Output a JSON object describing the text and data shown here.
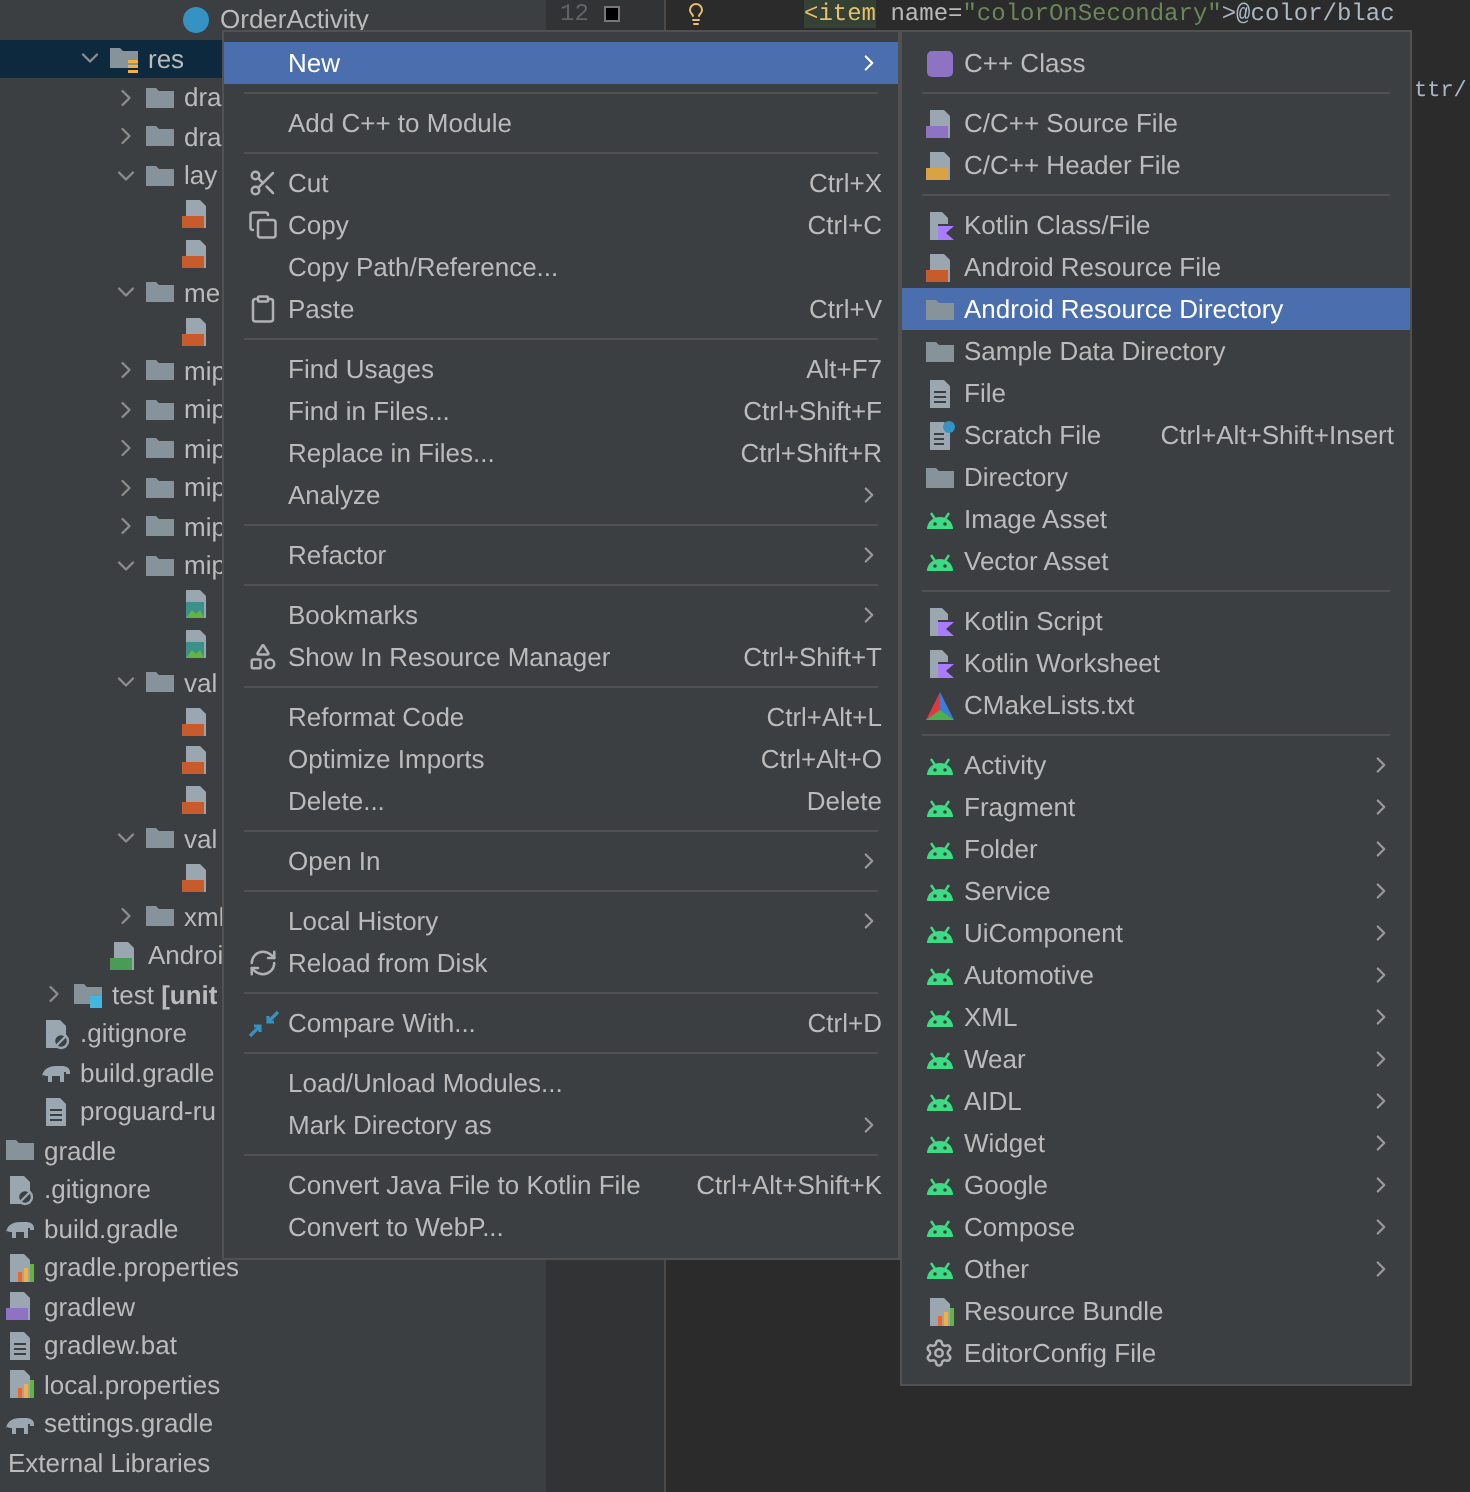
{
  "project_tree": {
    "sections": [
      {
        "kind": "source",
        "items": [
          {
            "label": "OrderActivity",
            "kind": "class",
            "selected": false
          }
        ]
      },
      {
        "kind": "main",
        "items": [
          {
            "label": "res",
            "kind": "res",
            "expanded": true,
            "selected": true,
            "children": [
              {
                "label": "dra",
                "kind": "folder",
                "expanded": false,
                "selected": false
              },
              {
                "label": "dra",
                "kind": "folder",
                "expanded": false,
                "selected": false
              },
              {
                "label": "lay",
                "kind": "folder",
                "expanded": true,
                "selected": false,
                "children": [
                  {
                    "kind": "xml",
                    "selected": false
                  },
                  {
                    "kind": "xml",
                    "selected": false
                  }
                ]
              },
              {
                "label": "me",
                "kind": "folder",
                "expanded": true,
                "selected": false,
                "children": [
                  {
                    "kind": "xml",
                    "selected": false
                  }
                ]
              },
              {
                "label": "mip",
                "kind": "folder",
                "expanded": false,
                "selected": false
              },
              {
                "label": "mip",
                "kind": "folder",
                "expanded": false,
                "selected": false
              },
              {
                "label": "mip",
                "kind": "folder",
                "expanded": false,
                "selected": false
              },
              {
                "label": "mip",
                "kind": "folder",
                "expanded": false,
                "selected": false
              },
              {
                "label": "mip",
                "kind": "folder",
                "expanded": false,
                "selected": false
              },
              {
                "label": "mip",
                "kind": "folder",
                "expanded": true,
                "selected": false,
                "children": [
                  {
                    "kind": "image",
                    "selected": false
                  },
                  {
                    "kind": "image",
                    "selected": false
                  }
                ]
              },
              {
                "label": "val",
                "kind": "folder",
                "expanded": true,
                "selected": false,
                "children": [
                  {
                    "kind": "xml",
                    "selected": false
                  },
                  {
                    "kind": "xml",
                    "selected": false
                  },
                  {
                    "kind": "xml",
                    "selected": false
                  }
                ]
              },
              {
                "label": "val",
                "kind": "folder",
                "expanded": true,
                "selected": false,
                "children": [
                  {
                    "kind": "xml",
                    "selected": false
                  }
                ]
              },
              {
                "label": "xml",
                "kind": "folder",
                "expanded": false,
                "selected": false
              }
            ]
          },
          {
            "label": "Androi",
            "kind": "manifest",
            "selected": false
          }
        ]
      },
      {
        "kind": "module",
        "items": [
          {
            "label": "test **[unit**",
            "kind": "test",
            "expanded": false,
            "selected": false
          },
          {
            "label": ".gitignore",
            "kind": "ignore",
            "selected": false
          },
          {
            "label": "build.gradle",
            "kind": "gradle",
            "selected": false
          },
          {
            "label": "proguard-ru",
            "kind": "text",
            "selected": false
          }
        ]
      },
      {
        "kind": "project",
        "items": [
          {
            "label": "gradle",
            "kind": "folder",
            "selected": false
          },
          {
            "label": ".gitignore",
            "kind": "ignore",
            "selected": false
          },
          {
            "label": "build.gradle",
            "kind": "gradle",
            "selected": false
          },
          {
            "label": "gradle.properties",
            "kind": "properties",
            "selected": false
          },
          {
            "label": "gradlew",
            "kind": "script",
            "selected": false
          },
          {
            "label": "gradlew.bat",
            "kind": "text",
            "selected": false
          },
          {
            "label": "local.properties",
            "kind": "properties",
            "selected": false
          },
          {
            "label": "settings.gradle",
            "kind": "gradle",
            "selected": false
          },
          {
            "label": "External Libraries",
            "kind": "plain",
            "selected": false
          }
        ]
      }
    ]
  },
  "editor": {
    "line_number": "12",
    "code_line": [
      {
        "kind": "tag",
        "text": "<item"
      },
      {
        "kind": "attr",
        "text": " name="
      },
      {
        "kind": "string",
        "text": "\"colorOnSecondary\""
      },
      {
        "kind": "text",
        "text": ">@color/blac"
      }
    ],
    "fragment": "ttr/"
  },
  "context_menu": {
    "items": [
      {
        "kind": "plain",
        "label": "New",
        "submenu": true,
        "selected": true
      },
      {
        "kind": "separator"
      },
      {
        "kind": "plain",
        "label": "Add C++ to Module",
        "submenu": false,
        "selected": false
      },
      {
        "kind": "separator"
      },
      {
        "kind": "cut",
        "label": "Cut",
        "shortcut": "Ctrl+X",
        "submenu": false,
        "selected": false
      },
      {
        "kind": "copy",
        "label": "Copy",
        "shortcut": "Ctrl+C",
        "submenu": false,
        "selected": false
      },
      {
        "kind": "plain",
        "label": "Copy Path/Reference...",
        "submenu": false,
        "selected": false
      },
      {
        "kind": "paste",
        "label": "Paste",
        "shortcut": "Ctrl+V",
        "submenu": false,
        "selected": false
      },
      {
        "kind": "separator"
      },
      {
        "kind": "plain",
        "label": "Find Usages",
        "shortcut": "Alt+F7",
        "submenu": false,
        "selected": false
      },
      {
        "kind": "plain",
        "label": "Find in Files...",
        "shortcut": "Ctrl+Shift+F",
        "submenu": false,
        "selected": false
      },
      {
        "kind": "plain",
        "label": "Replace in Files...",
        "shortcut": "Ctrl+Shift+R",
        "submenu": false,
        "selected": false
      },
      {
        "kind": "plain",
        "label": "Analyze",
        "submenu": true,
        "selected": false
      },
      {
        "kind": "separator"
      },
      {
        "kind": "plain",
        "label": "Refactor",
        "submenu": true,
        "selected": false
      },
      {
        "kind": "separator"
      },
      {
        "kind": "plain",
        "label": "Bookmarks",
        "submenu": true,
        "selected": false
      },
      {
        "kind": "resources",
        "label": "Show In Resource Manager",
        "shortcut": "Ctrl+Shift+T",
        "submenu": false,
        "selected": false
      },
      {
        "kind": "separator"
      },
      {
        "kind": "plain",
        "label": "Reformat Code",
        "shortcut": "Ctrl+Alt+L",
        "submenu": false,
        "selected": false
      },
      {
        "kind": "plain",
        "label": "Optimize Imports",
        "shortcut": "Ctrl+Alt+O",
        "submenu": false,
        "selected": false
      },
      {
        "kind": "plain",
        "label": "Delete...",
        "shortcut": "Delete",
        "submenu": false,
        "selected": false
      },
      {
        "kind": "separator"
      },
      {
        "kind": "plain",
        "label": "Open In",
        "submenu": true,
        "selected": false
      },
      {
        "kind": "separator"
      },
      {
        "kind": "plain",
        "label": "Local History",
        "submenu": true,
        "selected": false
      },
      {
        "kind": "reload",
        "label": "Reload from Disk",
        "submenu": false,
        "selected": false
      },
      {
        "kind": "separator"
      },
      {
        "kind": "compare",
        "label": "Compare With...",
        "shortcut": "Ctrl+D",
        "submenu": false,
        "selected": false
      },
      {
        "kind": "separator"
      },
      {
        "kind": "plain",
        "label": "Load/Unload Modules...",
        "submenu": false,
        "selected": false
      },
      {
        "kind": "plain",
        "label": "Mark Directory as",
        "submenu": true,
        "selected": false
      },
      {
        "kind": "separator"
      },
      {
        "kind": "plain",
        "label": "Convert Java File to Kotlin File",
        "shortcut": "Ctrl+Alt+Shift+K",
        "submenu": false,
        "selected": false
      },
      {
        "kind": "plain",
        "label": "Convert to WebP...",
        "submenu": false,
        "selected": false
      }
    ]
  },
  "new_submenu": {
    "items": [
      {
        "kind": "cpp_class",
        "label": "C++ Class",
        "submenu": false,
        "selected": false
      },
      {
        "kind": "separator"
      },
      {
        "kind": "cpp_source",
        "label": "C/C++ Source File",
        "submenu": false,
        "selected": false
      },
      {
        "kind": "cpp_header",
        "label": "C/C++ Header File",
        "submenu": false,
        "selected": false
      },
      {
        "kind": "separator"
      },
      {
        "kind": "kotlin",
        "label": "Kotlin Class/File",
        "submenu": false,
        "selected": false
      },
      {
        "kind": "resource_file",
        "label": "Android Resource File",
        "submenu": false,
        "selected": false
      },
      {
        "kind": "directory",
        "label": "Android Resource Directory",
        "submenu": false,
        "selected": true
      },
      {
        "kind": "directory",
        "label": "Sample Data Directory",
        "submenu": false,
        "selected": false
      },
      {
        "kind": "file",
        "label": "File",
        "submenu": false,
        "selected": false
      },
      {
        "kind": "scratch",
        "label": "Scratch File",
        "shortcut": "Ctrl+Alt+Shift+Insert",
        "submenu": false,
        "selected": false
      },
      {
        "kind": "directory",
        "label": "Directory",
        "submenu": false,
        "selected": false
      },
      {
        "kind": "android",
        "label": "Image Asset",
        "submenu": false,
        "selected": false
      },
      {
        "kind": "android",
        "label": "Vector Asset",
        "submenu": false,
        "selected": false
      },
      {
        "kind": "separator"
      },
      {
        "kind": "kotlin",
        "label": "Kotlin Script",
        "submenu": false,
        "selected": false
      },
      {
        "kind": "kotlin",
        "label": "Kotlin Worksheet",
        "submenu": false,
        "selected": false
      },
      {
        "kind": "cmake",
        "label": "CMakeLists.txt",
        "submenu": false,
        "selected": false
      },
      {
        "kind": "separator"
      },
      {
        "kind": "android",
        "label": "Activity",
        "submenu": true,
        "selected": false
      },
      {
        "kind": "android",
        "label": "Fragment",
        "submenu": true,
        "selected": false
      },
      {
        "kind": "android",
        "label": "Folder",
        "submenu": true,
        "selected": false
      },
      {
        "kind": "android",
        "label": "Service",
        "submenu": true,
        "selected": false
      },
      {
        "kind": "android",
        "label": "UiComponent",
        "submenu": true,
        "selected": false
      },
      {
        "kind": "android",
        "label": "Automotive",
        "submenu": true,
        "selected": false
      },
      {
        "kind": "android",
        "label": "XML",
        "submenu": true,
        "selected": false
      },
      {
        "kind": "android",
        "label": "Wear",
        "submenu": true,
        "selected": false
      },
      {
        "kind": "android",
        "label": "AIDL",
        "submenu": true,
        "selected": false
      },
      {
        "kind": "android",
        "label": "Widget",
        "submenu": true,
        "selected": false
      },
      {
        "kind": "android",
        "label": "Google",
        "submenu": true,
        "selected": false
      },
      {
        "kind": "android",
        "label": "Compose",
        "submenu": true,
        "selected": false
      },
      {
        "kind": "android",
        "label": "Other",
        "submenu": true,
        "selected": false
      },
      {
        "kind": "bundle",
        "label": "Resource Bundle",
        "submenu": false,
        "selected": false
      },
      {
        "kind": "editorconfig",
        "label": "EditorConfig File",
        "submenu": false,
        "selected": false
      }
    ]
  }
}
